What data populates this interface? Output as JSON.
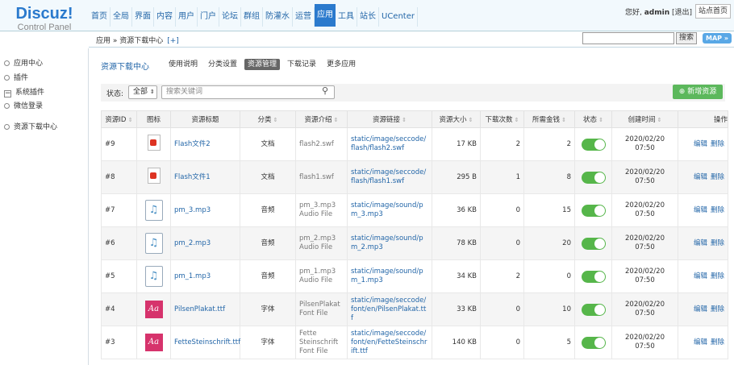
{
  "header": {
    "logo_main": "Discuz!",
    "logo_sub": "Control Panel",
    "nav": [
      "首页",
      "全局",
      "界面",
      "内容",
      "用户",
      "门户",
      "论坛",
      "群组",
      "防灌水",
      "运营",
      "应用",
      "工具",
      "站长",
      "UCenter"
    ],
    "active_nav": "应用",
    "greeting": "您好, ",
    "username": "admin",
    "logout": "[退出]",
    "home_button": "站点首页"
  },
  "subbar": {
    "breadcrumb": "应用 » 资源下载中心",
    "add": "[+]",
    "search_button": "搜索",
    "map": "MAP »"
  },
  "sidebar": [
    "应用中心",
    "插件",
    "系统插件",
    "微信登录",
    "资源下载中心"
  ],
  "page": {
    "title": "资源下载中心",
    "tabs": [
      "使用说明",
      "分类设置",
      "资源管理",
      "下载记录",
      "更多应用"
    ],
    "active_tab": "资源管理"
  },
  "filter": {
    "status_label": "状态:",
    "status_value": "全部",
    "search_placeholder": "搜索关键词",
    "add_button": "新增资源"
  },
  "table": {
    "headers": [
      "资源ID",
      "图标",
      "资源标题",
      "分类",
      "资源介绍",
      "资源链接",
      "资源大小",
      "下载次数",
      "所需金钱",
      "状态",
      "创建时间",
      "操作"
    ],
    "rows": [
      {
        "id": "#9",
        "icon": "pdf",
        "title": "Flash文件2",
        "category": "文档",
        "intro": "flash2.swf",
        "link": "static/image/seccode/flash/flash2.swf",
        "size": "17 KB",
        "downloads": "2",
        "cost": "2",
        "status": "on",
        "created": "2020/02/20 07:50"
      },
      {
        "id": "#8",
        "icon": "pdf",
        "title": "Flash文件1",
        "category": "文档",
        "intro": "flash1.swf",
        "link": "static/image/seccode/flash/flash1.swf",
        "size": "295 B",
        "downloads": "1",
        "cost": "8",
        "status": "on",
        "created": "2020/02/20 07:50"
      },
      {
        "id": "#7",
        "icon": "music",
        "title": "pm_3.mp3",
        "category": "音频",
        "intro": "pm_3.mp3 Audio File",
        "link": "static/image/sound/pm_3.mp3",
        "size": "36 KB",
        "downloads": "0",
        "cost": "15",
        "status": "on",
        "created": "2020/02/20 07:50"
      },
      {
        "id": "#6",
        "icon": "music",
        "title": "pm_2.mp3",
        "category": "音频",
        "intro": "pm_2.mp3 Audio File",
        "link": "static/image/sound/pm_2.mp3",
        "size": "78 KB",
        "downloads": "0",
        "cost": "20",
        "status": "on",
        "created": "2020/02/20 07:50"
      },
      {
        "id": "#5",
        "icon": "music",
        "title": "pm_1.mp3",
        "category": "音频",
        "intro": "pm_1.mp3 Audio File",
        "link": "static/image/sound/pm_1.mp3",
        "size": "34 KB",
        "downloads": "2",
        "cost": "0",
        "status": "on",
        "created": "2020/02/20 07:50"
      },
      {
        "id": "#4",
        "icon": "font",
        "title": "PilsenPlakat.ttf",
        "category": "字体",
        "intro": "PilsenPlakat Font File",
        "link": "static/image/seccode/font/en/PilsenPlakat.ttf",
        "size": "33 KB",
        "downloads": "0",
        "cost": "10",
        "status": "on",
        "created": "2020/02/20 07:50"
      },
      {
        "id": "#3",
        "icon": "font",
        "title": "FetteSteinschrift.ttf",
        "category": "字体",
        "intro": "Fette Steinschrift Font File",
        "link": "static/image/seccode/font/en/FetteSteinschrift.ttf",
        "size": "140 KB",
        "downloads": "0",
        "cost": "5",
        "status": "on",
        "created": "2020/02/20 07:50"
      }
    ],
    "edit": "编辑",
    "delete": "删除"
  }
}
